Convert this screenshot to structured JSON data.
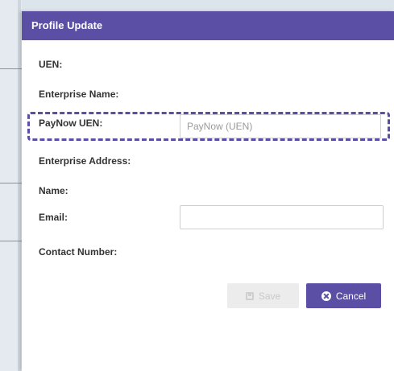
{
  "modal": {
    "title": "Profile Update",
    "fields": {
      "uen": {
        "label": "UEN:"
      },
      "enterprise_name": {
        "label": "Enterprise Name:"
      },
      "paynow_uen": {
        "label": "PayNow UEN:",
        "value": "",
        "placeholder": "PayNow (UEN)"
      },
      "enterprise_address": {
        "label": "Enterprise Address:"
      },
      "name": {
        "label": "Name:"
      },
      "email": {
        "label": "Email:",
        "value": "",
        "placeholder": ""
      },
      "contact_number": {
        "label": "Contact Number:"
      }
    },
    "buttons": {
      "save_label": "Save",
      "cancel_label": "Cancel"
    }
  },
  "icons": {
    "save": "floppy-disk-icon",
    "cancel": "close-circle-icon"
  },
  "colors": {
    "header": "#5b4ea5",
    "cancel_button": "#5b4ea5",
    "highlight_border": "#5b4ea5",
    "save_button_disabled": "#ececec"
  }
}
